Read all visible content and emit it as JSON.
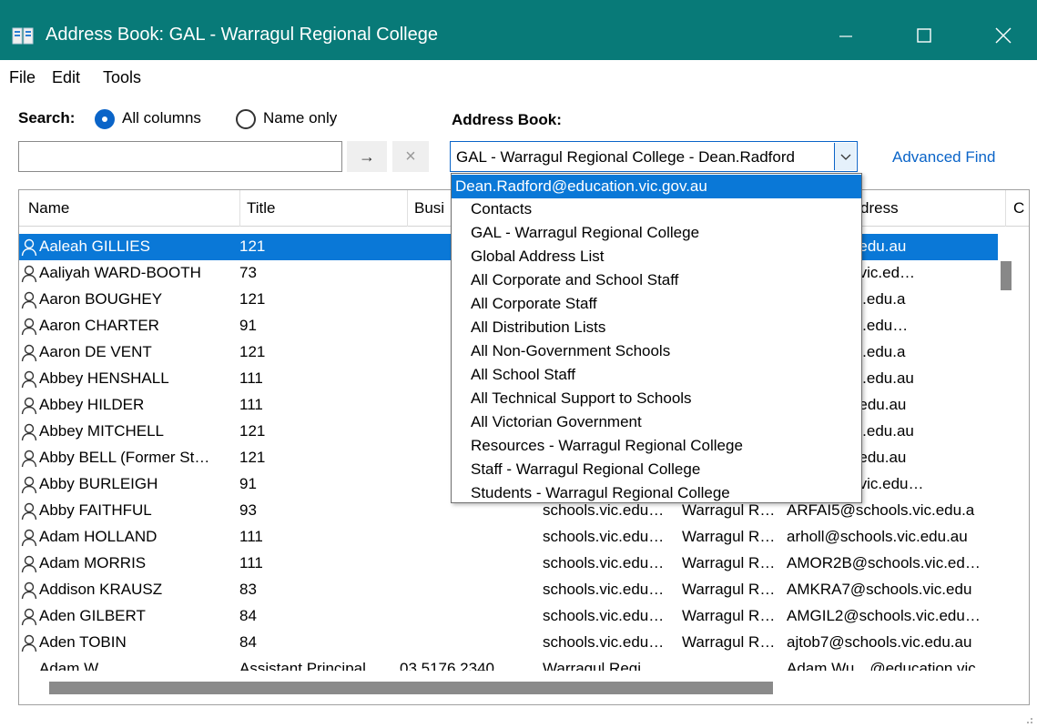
{
  "window": {
    "title": "Address Book: GAL - Warragul Regional College"
  },
  "menu": [
    "File",
    "Edit",
    "Tools"
  ],
  "search": {
    "label": "Search:",
    "options": [
      "All columns",
      "Name only"
    ],
    "selected": "All columns",
    "value": ""
  },
  "address_book": {
    "label": "Address Book:",
    "selected": "GAL - Warragul Regional College - Dean.Radford",
    "advanced_find": "Advanced Find",
    "options": [
      "Dean.Radford@education.vic.gov.au",
      "Contacts",
      "GAL - Warragul Regional College",
      "Global Address List",
      "All Corporate and School Staff",
      "All Corporate Staff",
      "All Distribution Lists",
      "All Non-Government Schools",
      "All School Staff",
      "All Technical Support to Schools",
      "All Victorian Government",
      "Resources - Warragul Regional College",
      "Staff - Warragul Regional College",
      "Students - Warragul Regional College"
    ],
    "highlighted_option": "Dean.Radford@education.vic.gov.au"
  },
  "columns": [
    "Name",
    "Title",
    "Busi",
    "dress",
    "C"
  ],
  "rows": [
    {
      "name": "Aaleah GILLIES",
      "title": "121",
      "company": "",
      "location": "",
      "email": "chools.vic.edu.au",
      "selected": true
    },
    {
      "name": "Aaliyah WARD-BOOTH",
      "title": "73",
      "company": "",
      "location": "",
      "email": "@schools.vic.ed…"
    },
    {
      "name": "Aaron BOUGHEY",
      "title": "121",
      "company": "",
      "location": "",
      "email": "schools.vic.edu.a"
    },
    {
      "name": "Aaron CHARTER",
      "title": "91",
      "company": "",
      "location": "",
      "email": "schools.vic.edu…"
    },
    {
      "name": "Aaron DE VENT",
      "title": "121",
      "company": "",
      "location": "",
      "email": "schools.vic.edu.a"
    },
    {
      "name": "Abbey HENSHALL",
      "title": "111",
      "company": "",
      "location": "",
      "email": "schools.vic.edu.au"
    },
    {
      "name": "Abbey HILDER",
      "title": "111",
      "company": "",
      "location": "",
      "email": "chools.vic.edu.au"
    },
    {
      "name": "Abbey MITCHELL",
      "title": "121",
      "company": "",
      "location": "",
      "email": "schools.vic.edu.au"
    },
    {
      "name": "Abby BELL (Former St…",
      "title": "121",
      "company": "",
      "location": "",
      "email": "chools.vic.edu.au"
    },
    {
      "name": "Abby BURLEIGH",
      "title": "91",
      "company": "",
      "location": "",
      "email": "@schools.vic.edu…"
    },
    {
      "name": "Abby FAITHFUL",
      "title": "93",
      "company": "schools.vic.edu…",
      "location": "Warragul R…",
      "email": "ARFAI5@schools.vic.edu.a"
    },
    {
      "name": "Adam HOLLAND",
      "title": "111",
      "company": "schools.vic.edu…",
      "location": "Warragul R…",
      "email": "arholl@schools.vic.edu.au"
    },
    {
      "name": "Adam MORRIS",
      "title": "111",
      "company": "schools.vic.edu…",
      "location": "Warragul R…",
      "email": "AMOR2B@schools.vic.ed…"
    },
    {
      "name": "Addison KRAUSZ",
      "title": "83",
      "company": "schools.vic.edu…",
      "location": "Warragul R…",
      "email": "AMKRA7@schools.vic.edu"
    },
    {
      "name": "Aden GILBERT",
      "title": "84",
      "company": "schools.vic.edu…",
      "location": "Warragul R…",
      "email": "AMGIL2@schools.vic.edu…"
    },
    {
      "name": "Aden TOBIN",
      "title": "84",
      "company": "schools.vic.edu…",
      "location": "Warragul R…",
      "email": "ajtob7@schools.vic.edu.au"
    }
  ],
  "partial_row": {
    "name": "Adam W…",
    "title": "Assistant Principal",
    "phone": "03 5176 2340",
    "location": "Warragul Regi…",
    "email": "Adam.Wu…@education.vic"
  },
  "colors": {
    "titlebar": "#087a78",
    "accent": "#0a78d7",
    "link": "#0a64c8"
  }
}
